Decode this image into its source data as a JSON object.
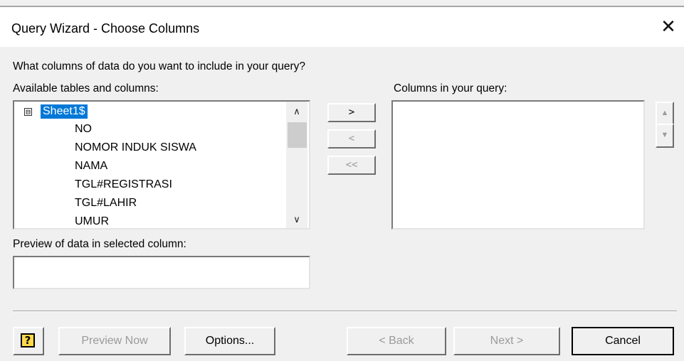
{
  "dialog": {
    "title": "Query Wizard - Choose Columns",
    "close_icon": "close-icon"
  },
  "prompt": "What columns of data do you want to include in your query?",
  "available": {
    "label": "Available tables and columns:",
    "root": {
      "expander": "⊟",
      "label": "Sheet1$",
      "selected": true
    },
    "items": [
      "NO",
      "NOMOR INDUK SISWA",
      "NAMA",
      "TGL#REGISTRASI",
      "TGL#LAHIR",
      "UMUR"
    ]
  },
  "move_buttons": {
    "add": ">",
    "remove": "<",
    "remove_all": "<<"
  },
  "query_columns": {
    "label": "Columns in your query:",
    "items": [],
    "up_icon": "▲",
    "down_icon": "▼"
  },
  "preview": {
    "label": "Preview of data in selected column:",
    "value": ""
  },
  "footer": {
    "help_glyph": "?",
    "preview_now": "Preview Now",
    "options": "Options...",
    "back": "< Back",
    "next": "Next >",
    "cancel": "Cancel"
  },
  "scroll_icons": {
    "up": "∧",
    "down": "∨"
  },
  "colors": {
    "selection": "#0078d7",
    "dialog_bg": "#f0f0f0",
    "title_bg": "#ffffff"
  }
}
